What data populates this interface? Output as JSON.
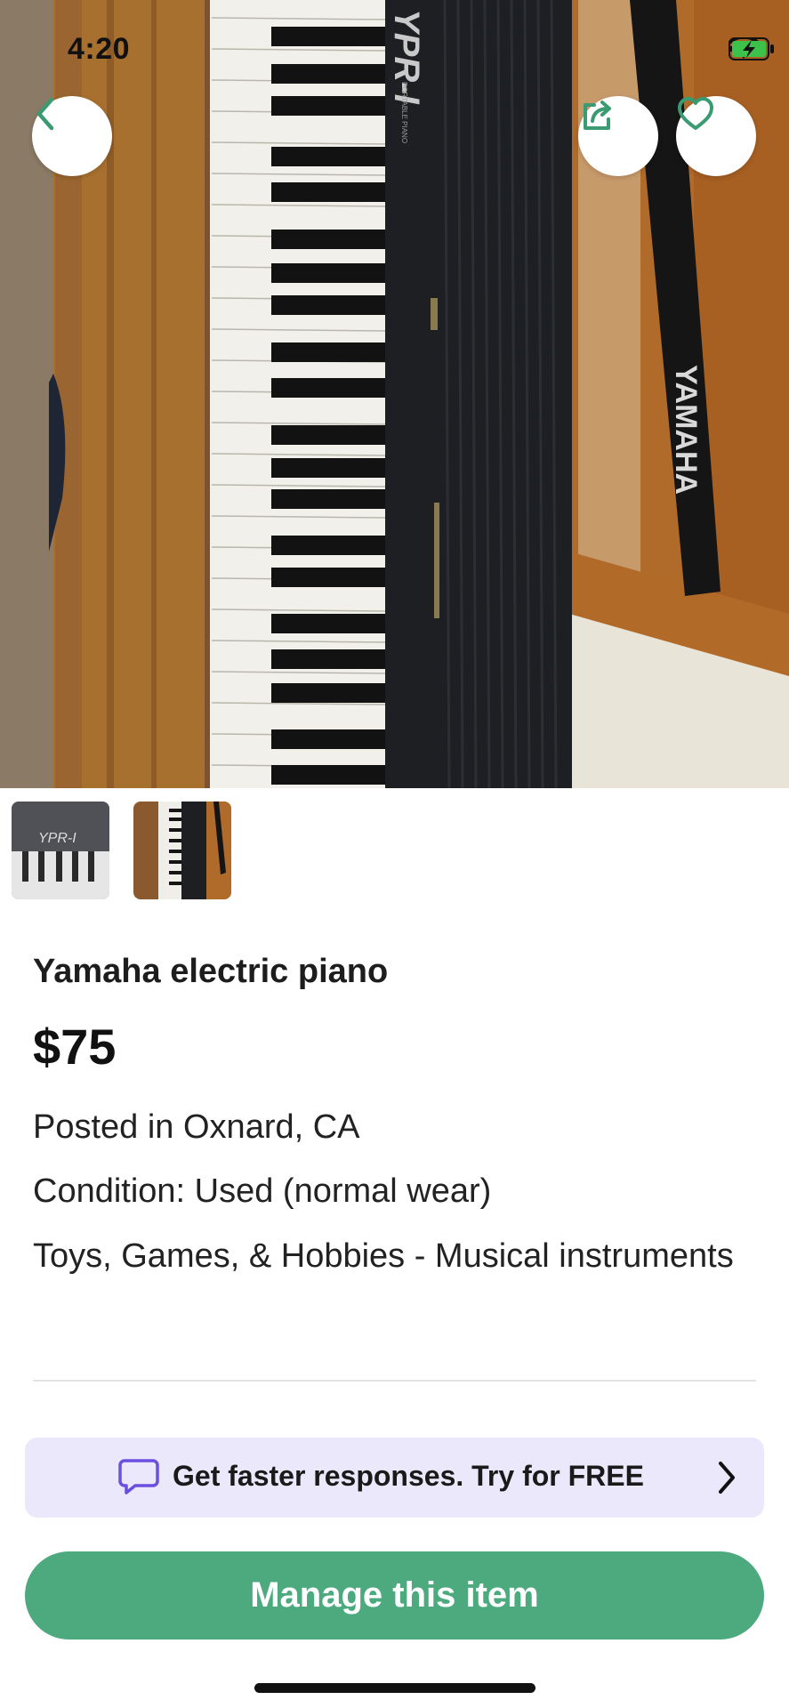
{
  "status_bar": {
    "time": "4:20",
    "icons": [
      "signal-icon",
      "wifi-icon",
      "battery-charging-icon"
    ]
  },
  "hero": {
    "image_description_icon": "photo-piano",
    "keyboard_brand_text": "YPR-I",
    "keyboard_sub_text": "PORTABLE PIANO",
    "case_brand_text": "YAMAHA",
    "buttons": {
      "back_icon": "chevron-left-icon",
      "share_icon": "share-icon",
      "favorite_icon": "heart-icon"
    }
  },
  "thumbnails": [
    {
      "name": "photo-1",
      "selected": false
    },
    {
      "name": "photo-2",
      "selected": true
    }
  ],
  "listing": {
    "title": "Yamaha electric piano",
    "price": "$75",
    "posted": "Posted in Oxnard, CA",
    "condition": "Condition: Used (normal wear)",
    "category": "Toys, Games, & Hobbies - Musical instruments"
  },
  "promo": {
    "text": "Get faster responses.  Try for FREE",
    "icon": "chat-bubble-icon",
    "chevron": "chevron-right-icon"
  },
  "cta": {
    "label": "Manage this item"
  },
  "colors": {
    "accent_green": "#4caa7e",
    "promo_bg": "#ebe8fb",
    "promo_icon": "#6a4fe0",
    "text_dark": "#1b1b1b"
  }
}
